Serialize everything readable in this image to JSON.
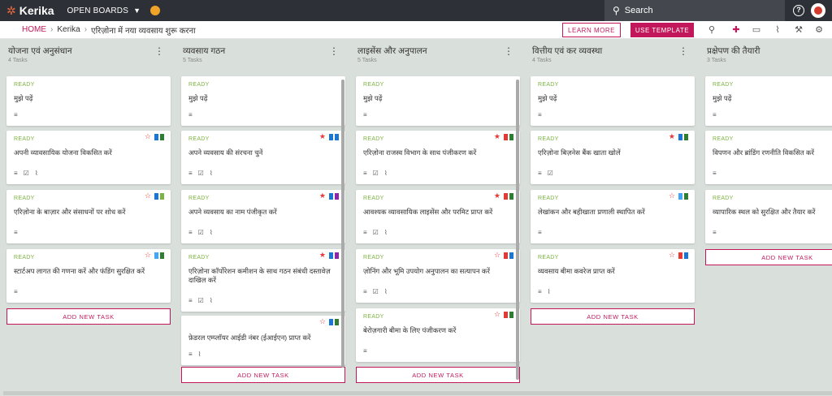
{
  "app": {
    "logo": "Kerika",
    "boards_label": "OPEN BOARDS",
    "search_placeholder": "Search"
  },
  "breadcrumb": {
    "home": "HOME",
    "org": "Kerika",
    "board": "एरिज़ोना में नया व्यवसाय शुरू करना"
  },
  "toolbar": {
    "learn_more": "LEARN MORE",
    "use_template": "USE TEMPLATE",
    "icons": [
      "search-icon",
      "add-person-icon",
      "chat-icon",
      "attachment-icon",
      "wrench-icon",
      "gear-icon"
    ]
  },
  "colors": {
    "accent": "#c2185b",
    "ready": "#7cb342",
    "topbar": "#2d3036",
    "blue": "#1976d2",
    "green": "#2e7d32",
    "red": "#e53935",
    "purple": "#8e24aa",
    "lightblue": "#42a5f5",
    "lightgreen": "#7cb342"
  },
  "add_task_label": "ADD NEW TASK",
  "columns": [
    {
      "title": "योजना एवं अनुसंधान",
      "count": "4 Tasks",
      "cards": [
        {
          "status": "READY",
          "title": "मुझे पढ़ें",
          "icons": [
            "description-icon"
          ],
          "star": "",
          "flags": []
        },
        {
          "status": "READY",
          "title": "अपनी व्यावसायिक योजना विकसित करें",
          "icons": [
            "description-icon",
            "checklist-icon",
            "attachment-icon"
          ],
          "star": "outline",
          "flags": [
            "blue",
            "green"
          ]
        },
        {
          "status": "READY",
          "title": "एरिज़ोना के बाज़ार और संसाधनों पर शोध करें",
          "icons": [
            "description-icon"
          ],
          "star": "outline",
          "flags": [
            "blue",
            "lightgreen"
          ]
        },
        {
          "status": "READY",
          "title": "स्टार्टअप लागत की गणना करें और फंडिंग सुरक्षित करें",
          "icons": [
            "description-icon"
          ],
          "star": "outline",
          "flags": [
            "lightblue",
            "green"
          ]
        }
      ]
    },
    {
      "title": "व्यवसाय गठन",
      "count": "5 Tasks",
      "cards": [
        {
          "status": "READY",
          "title": "मुझे पढ़ें",
          "icons": [
            "description-icon"
          ],
          "star": "",
          "flags": []
        },
        {
          "status": "READY",
          "title": "अपने व्यवसाय की संरचना चुनें",
          "icons": [
            "description-icon",
            "checklist-icon",
            "attachment-icon"
          ],
          "star": "filled",
          "flags": [
            "blue",
            "blue"
          ]
        },
        {
          "status": "READY",
          "title": "अपने व्यवसाय का नाम पंजीकृत करें",
          "icons": [
            "description-icon",
            "checklist-icon",
            "attachment-icon"
          ],
          "star": "filled",
          "flags": [
            "blue",
            "purple"
          ]
        },
        {
          "status": "READY",
          "title": "एरिज़ोना कॉर्पोरेशन कमीशन के साथ गठन संबंधी दस्तावेज़ दाखिल करें",
          "icons": [
            "description-icon",
            "checklist-icon",
            "attachment-icon"
          ],
          "star": "filled",
          "flags": [
            "blue",
            "purple"
          ]
        },
        {
          "status": "",
          "title": "फ़ेडरल एम्प्लॉयर आईडी नंबर (ईआईएन) प्राप्त करें",
          "icons": [
            "description-icon",
            "attachment-icon"
          ],
          "star": "outline",
          "flags": [
            "blue",
            "green"
          ]
        }
      ]
    },
    {
      "title": "लाइसेंस और अनुपालन",
      "count": "5 Tasks",
      "cards": [
        {
          "status": "READY",
          "title": "मुझे पढ़ें",
          "icons": [
            "description-icon"
          ],
          "star": "",
          "flags": []
        },
        {
          "status": "READY",
          "title": "एरिज़ोना राजस्व विभाग के साथ पंजीकरण करें",
          "icons": [
            "description-icon",
            "checklist-icon",
            "attachment-icon"
          ],
          "star": "filled",
          "flags": [
            "red",
            "green"
          ]
        },
        {
          "status": "READY",
          "title": "आवश्यक व्यावसायिक लाइसेंस और परमिट प्राप्त करें",
          "icons": [
            "description-icon",
            "checklist-icon",
            "attachment-icon"
          ],
          "star": "filled",
          "flags": [
            "red",
            "green"
          ]
        },
        {
          "status": "READY",
          "title": "ज़ोनिंग और भूमि उपयोग अनुपालन का सत्यापन करें",
          "icons": [
            "description-icon",
            "checklist-icon",
            "attachment-icon"
          ],
          "star": "outline",
          "flags": [
            "red",
            "blue"
          ]
        },
        {
          "status": "READY",
          "title": "बेरोज़गारी बीमा के लिए पंजीकरण करें",
          "icons": [
            "description-icon"
          ],
          "star": "outline",
          "flags": [
            "red",
            "green"
          ]
        }
      ]
    },
    {
      "title": "वित्तीय एवं कर व्यवस्था",
      "count": "4 Tasks",
      "cards": [
        {
          "status": "READY",
          "title": "मुझे पढ़ें",
          "icons": [
            "description-icon"
          ],
          "star": "",
          "flags": []
        },
        {
          "status": "READY",
          "title": "एरिज़ोना बिज़नेस बैंक खाता खोलें",
          "icons": [
            "description-icon",
            "checklist-icon"
          ],
          "star": "filled",
          "flags": [
            "blue",
            "green"
          ]
        },
        {
          "status": "READY",
          "title": "लेखांकन और बहीखाता प्रणाली स्थापित करें",
          "icons": [
            "description-icon"
          ],
          "star": "outline",
          "flags": [
            "lightblue",
            "green"
          ]
        },
        {
          "status": "READY",
          "title": "व्यवसाय बीमा कवरेज प्राप्त करें",
          "icons": [
            "description-icon",
            "attachment-icon"
          ],
          "star": "outline",
          "flags": [
            "red",
            "blue"
          ]
        }
      ]
    },
    {
      "title": "प्रक्षेपण की तैयारी",
      "count": "3 Tasks",
      "cards": [
        {
          "status": "READY",
          "title": "मुझे पढ़ें",
          "icons": [
            "description-icon"
          ],
          "star": "",
          "flags": []
        },
        {
          "status": "READY",
          "title": "विपणन और ब्रांडिंग रणनीति विकसित करें",
          "icons": [
            "description-icon"
          ],
          "star": "outline",
          "flags": [
            "lightblue",
            "green"
          ]
        },
        {
          "status": "READY",
          "title": "व्यापारिक स्थल को सुरक्षित और तैयार करें",
          "icons": [
            "description-icon"
          ],
          "star": "outline",
          "flags": [
            "blue",
            "green"
          ]
        }
      ]
    }
  ]
}
